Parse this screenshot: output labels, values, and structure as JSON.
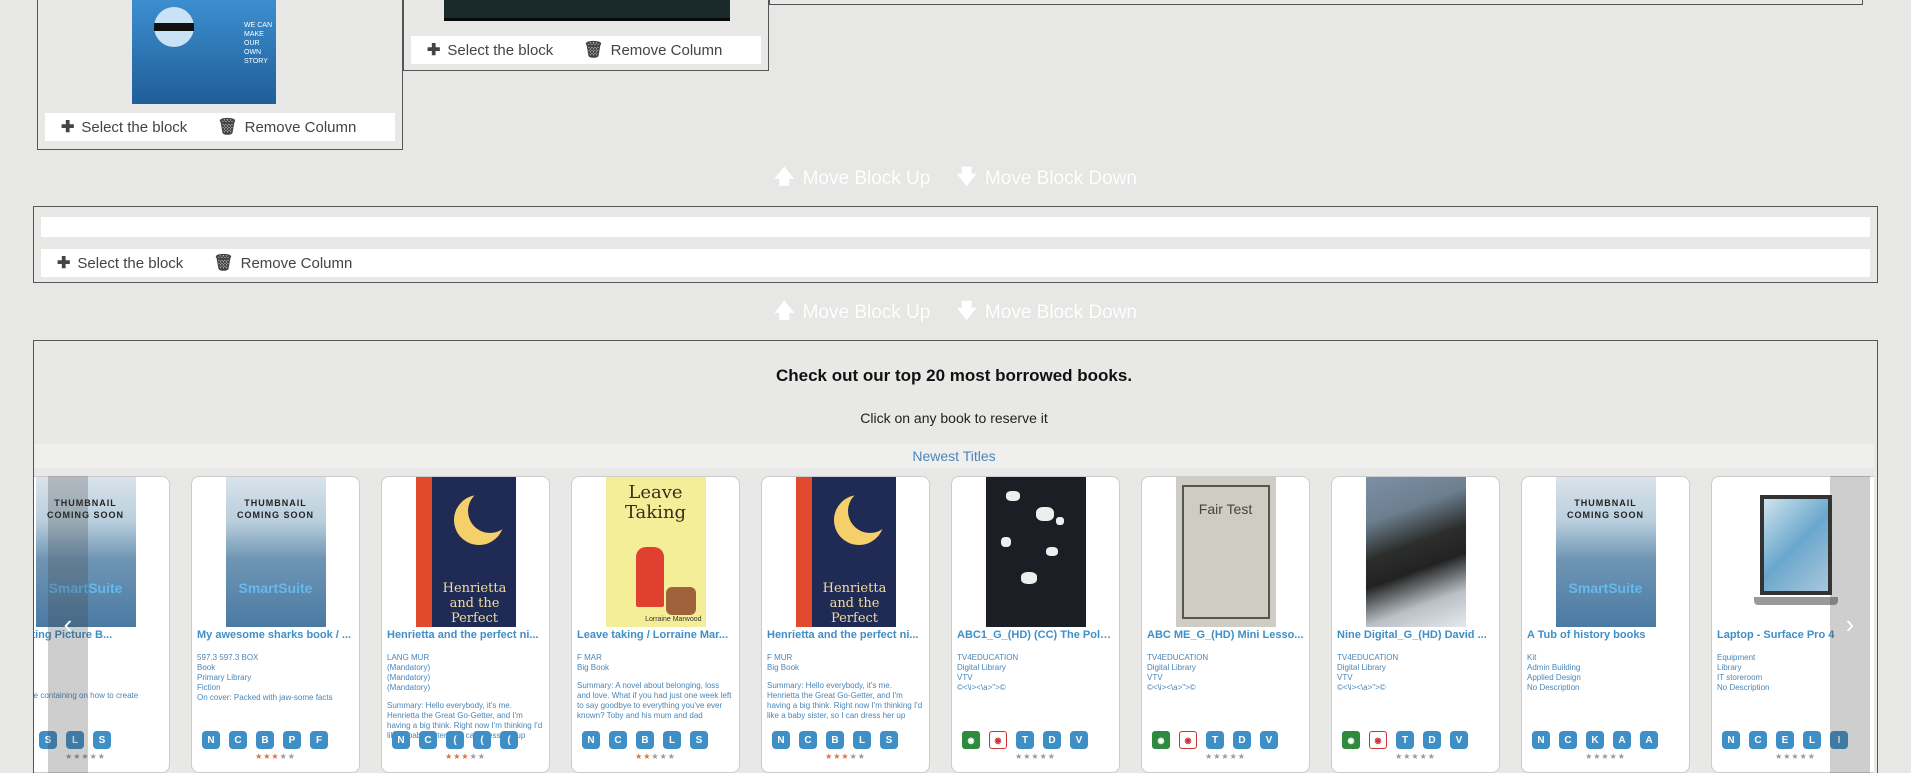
{
  "builder": {
    "select_label": "Select the block",
    "remove_label": "Remove Column",
    "move_up_label": "Move Block Up",
    "move_down_label": "Move Block Down"
  },
  "cover_text": {
    "blue_cover": "WE CAN MAKE OUR OWN STORY"
  },
  "section": {
    "heading": "Check out our top 20 most borrowed books.",
    "subtext": "Click on any book to reserve it",
    "tab": "Newest Titles"
  },
  "carousel": {
    "prev_icon": "chevron-left-icon",
    "next_icon": "chevron-right-icon",
    "cards": [
      {
        "title": "Creating Picture B...",
        "cover": "smartsuite",
        "cover_top": "THUMBNAIL COMING SOON",
        "cover_brand": "SmartSuite",
        "meta": [
          "an",
          "",
          ""
        ],
        "summary": "resource containing on how to create picture",
        "badges": [
          "C",
          "S",
          "L",
          "S"
        ],
        "stars": 0
      },
      {
        "title": "My awesome sharks book / ...",
        "cover": "smartsuite",
        "cover_top": "THUMBNAIL COMING SOON",
        "cover_brand": "SmartSuite",
        "meta": [
          "597.3 597.3 BOX",
          "Book",
          "Primary Library",
          "Fiction",
          "On cover: Packed with jaw-some facts"
        ],
        "summary": "",
        "badges": [
          "N",
          "C",
          "B",
          "P",
          "F"
        ],
        "stars": 3
      },
      {
        "title": "Henrietta and the perfect ni...",
        "cover": "henrietta",
        "cover_title": "Henrietta and the Perfect Night",
        "meta": [
          "LANG MUR",
          "(Mandatory)",
          "(Mandatory)",
          "(Mandatory)"
        ],
        "summary": "Summary: Hello everybody, it's me. Henrietta the Great Go-Getter, and I'm having a big think. Right now I'm thinking I'd like a baby sister, so I can dress her up",
        "badges": [
          "N",
          "C",
          "(",
          "(",
          "("
        ],
        "stars": 3
      },
      {
        "title": "Leave taking / Lorraine Mar...",
        "cover": "leave",
        "cover_title": "Leave Taking",
        "cover_author": "Lorraine Marwood",
        "meta": [
          "F MAR",
          "Big Book"
        ],
        "summary": "Summary: A novel about belonging, loss and love. What if you had just one week left to say goodbye to everything you've ever known? Toby and his mum and dad",
        "badges": [
          "N",
          "C",
          "B",
          "L",
          "S"
        ],
        "stars": 2
      },
      {
        "title": "Henrietta and the perfect ni...",
        "cover": "henrietta",
        "cover_title": "Henrietta and the Perfect Night",
        "meta": [
          "F MUR",
          "Big Book"
        ],
        "summary": "Summary: Hello everybody, it's me. Henrietta the Great Go-Getter, and I'm having a big think. Right now I'm thinking I'd like a baby sister, so I can dress her up",
        "badges": [
          "N",
          "C",
          "B",
          "L",
          "S"
        ],
        "stars": 3
      },
      {
        "title": "ABC1_G_(HD) (CC) The Pole...",
        "cover": "dark",
        "meta": [
          "TV4EDUCATION",
          "Digital Library",
          "VTV",
          "©<\\i><\\a>\">©"
        ],
        "summary": "",
        "badges": [
          "icon",
          "icon",
          "T",
          "D",
          "V"
        ],
        "stars": 0
      },
      {
        "title": "ABC ME_G_(HD) Mini Lesso...",
        "cover": "fair",
        "cover_title": "Fair Test",
        "meta": [
          "TV4EDUCATION",
          "Digital Library",
          "VTV",
          "©<\\i><\\a>\">©"
        ],
        "summary": "",
        "badges": [
          "icon",
          "icon",
          "T",
          "D",
          "V"
        ],
        "stars": 0
      },
      {
        "title": "Nine Digital_G_(HD) David ...",
        "cover": "mountain",
        "meta": [
          "TV4EDUCATION",
          "Digital Library",
          "VTV",
          "©<\\i><\\a>\">©"
        ],
        "summary": "",
        "badges": [
          "icon",
          "icon",
          "T",
          "D",
          "V"
        ],
        "stars": 0
      },
      {
        "title": "A Tub of history books",
        "cover": "smartsuite",
        "cover_top": "THUMBNAIL COMING SOON",
        "cover_brand": "SmartSuite",
        "meta": [
          "Kit",
          "Admin Building",
          "Applied Design",
          "No Description"
        ],
        "summary": "",
        "badges": [
          "N",
          "C",
          "K",
          "A",
          "A"
        ],
        "stars": 0
      },
      {
        "title": "Laptop - Surface Pro 4",
        "cover": "laptop",
        "meta": [
          "Equipment",
          "Library",
          "IT storeroom",
          "No Description"
        ],
        "summary": "",
        "badges": [
          "N",
          "C",
          "E",
          "L",
          "I"
        ],
        "stars": 0
      }
    ]
  }
}
